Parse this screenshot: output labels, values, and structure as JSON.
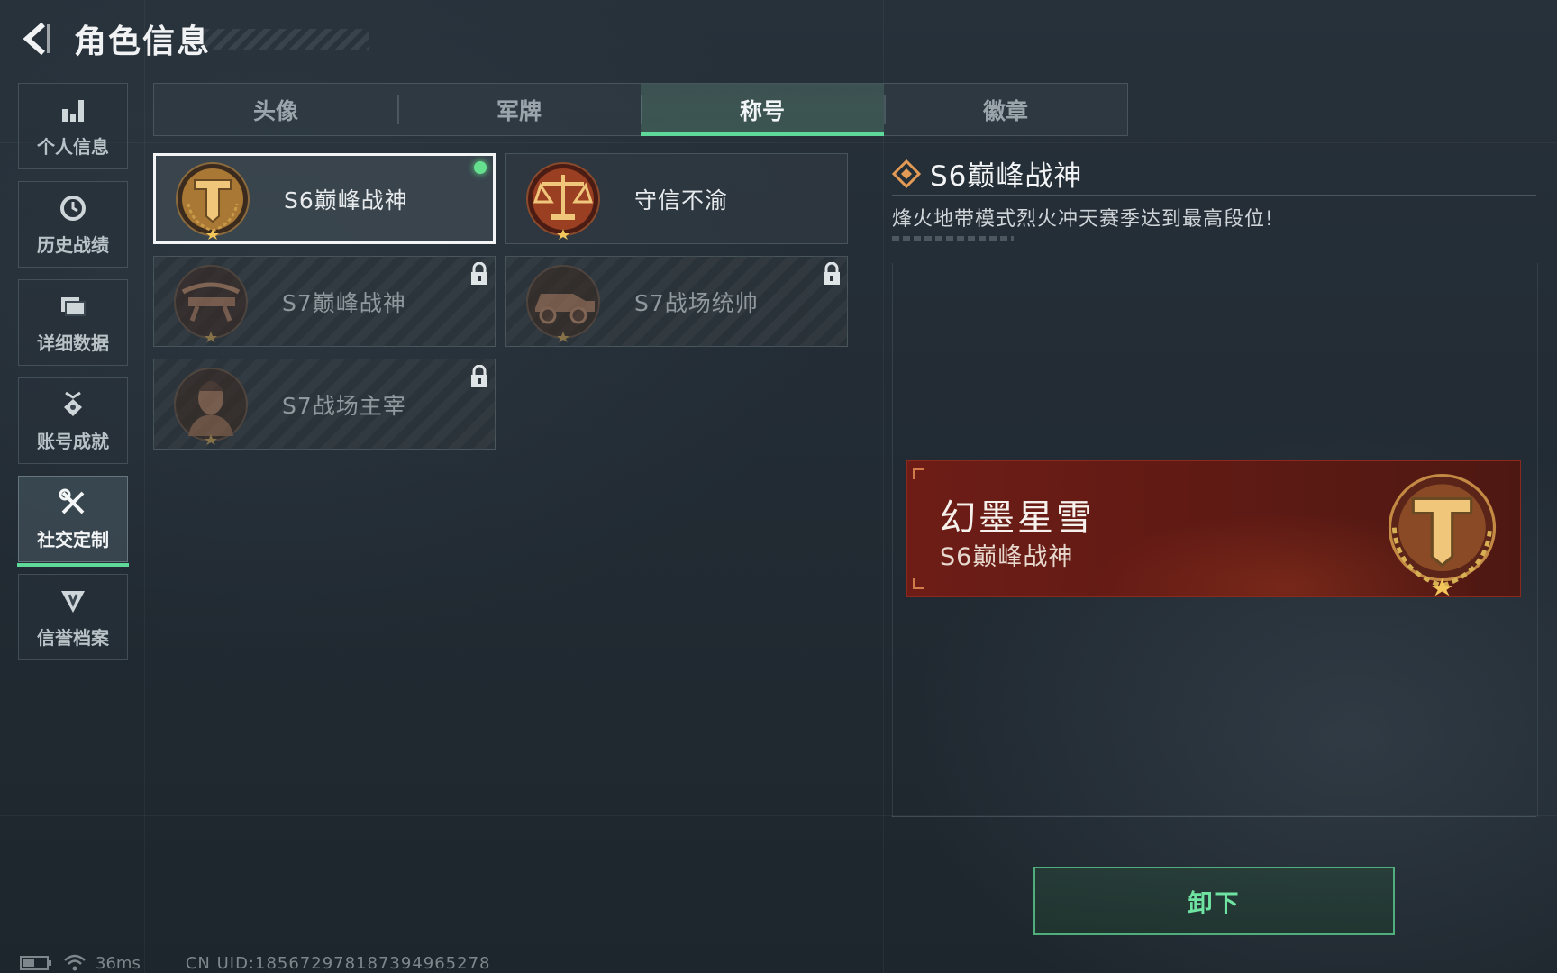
{
  "header": {
    "title": "角色信息"
  },
  "sidebar": {
    "items": [
      {
        "label": "个人信息",
        "icon": "bar-chart-icon"
      },
      {
        "label": "历史战绩",
        "icon": "clock-icon"
      },
      {
        "label": "详细数据",
        "icon": "folder-icon"
      },
      {
        "label": "账号成就",
        "icon": "medal-icon"
      },
      {
        "label": "社交定制",
        "icon": "tools-icon",
        "active": true
      },
      {
        "label": "信誉档案",
        "icon": "shield-badge-icon"
      }
    ]
  },
  "tabs": [
    {
      "label": "头像"
    },
    {
      "label": "军牌"
    },
    {
      "label": "称号",
      "active": true
    },
    {
      "label": "徽章"
    }
  ],
  "titles": [
    {
      "name": "S6巅峰战神",
      "emblem": "hammer-emblem",
      "locked": false,
      "equipped": true
    },
    {
      "name": "守信不渝",
      "emblem": "scales-emblem",
      "locked": false,
      "equipped": false
    },
    {
      "name": "S7巅峰战神",
      "emblem": "crossbow-emblem",
      "locked": true
    },
    {
      "name": "S7战场统帅",
      "emblem": "vehicle-emblem",
      "locked": true
    },
    {
      "name": "S7战场主宰",
      "emblem": "soldier-emblem",
      "locked": true
    }
  ],
  "detail": {
    "title": "S6巅峰战神",
    "description": "烽火地带模式烈火冲天赛季达到最高段位!"
  },
  "preview": {
    "player_name": "幻墨星雪",
    "title": "S6巅峰战神"
  },
  "actions": {
    "unequip_label": "卸下"
  },
  "status": {
    "ping": "36ms",
    "uid": "CN UID:185672978187394965278"
  },
  "colors": {
    "accent_green": "#5fd99a",
    "banner_red": "#6e1d16",
    "emblem_gold": "#c9924a"
  }
}
